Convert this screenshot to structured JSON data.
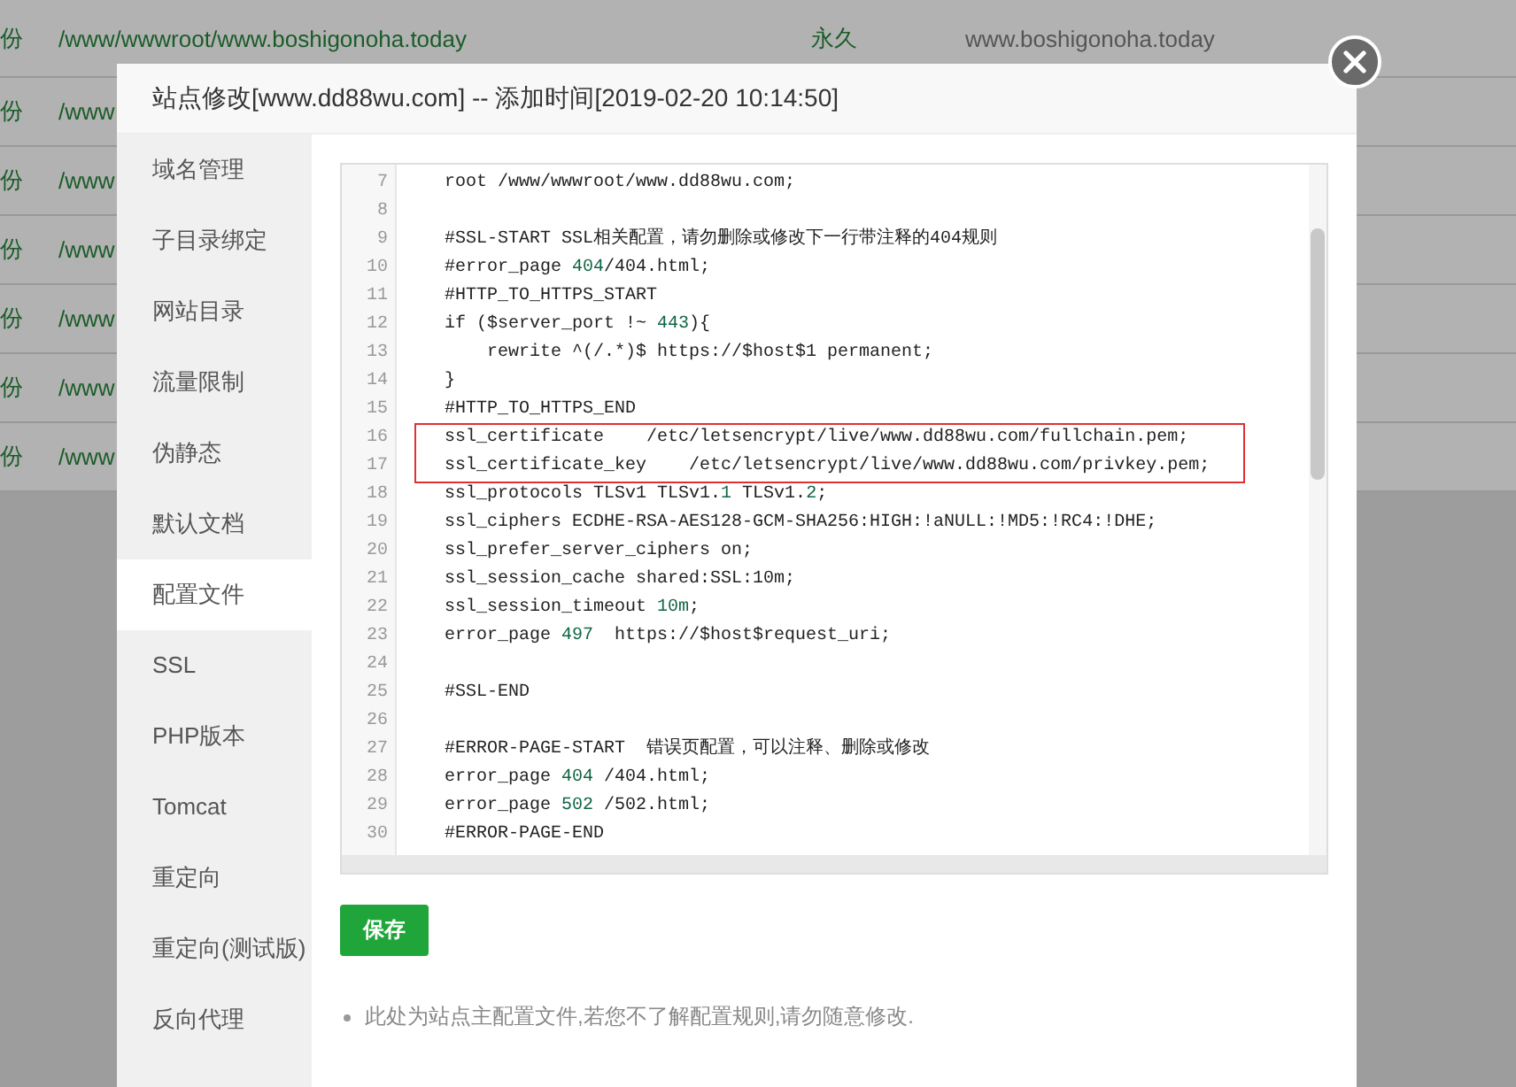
{
  "background_table": {
    "rows": [
      {
        "column_1": "份",
        "path": "/www/wwwroot/www.boshigonoha.today",
        "expiry": "永久",
        "domain": "www.boshigonoha.today"
      },
      {
        "column_1": "份",
        "path": "/www"
      },
      {
        "column_1": "份",
        "path": "/www"
      },
      {
        "column_1": "份",
        "path": "/www"
      },
      {
        "column_1": "份",
        "path": "/www"
      },
      {
        "column_1": "份",
        "path": "/www"
      },
      {
        "column_1": "份",
        "path": "/www"
      }
    ]
  },
  "dialog": {
    "title": "站点修改[www.dd88wu.com] -- 添加时间[2019-02-20 10:14:50]",
    "sidebar": {
      "items": [
        {
          "label": "域名管理",
          "selected": false
        },
        {
          "label": "子目录绑定",
          "selected": false
        },
        {
          "label": "网站目录",
          "selected": false
        },
        {
          "label": "流量限制",
          "selected": false
        },
        {
          "label": "伪静态",
          "selected": false
        },
        {
          "label": "默认文档",
          "selected": false
        },
        {
          "label": "配置文件",
          "selected": true
        },
        {
          "label": "SSL",
          "selected": false
        },
        {
          "label": "PHP版本",
          "selected": false
        },
        {
          "label": "Tomcat",
          "selected": false
        },
        {
          "label": "重定向",
          "selected": false
        },
        {
          "label": "重定向(测试版)",
          "selected": false
        },
        {
          "label": "反向代理",
          "selected": false
        }
      ]
    },
    "code": {
      "lines": [
        {
          "number": "7",
          "highlighted": false,
          "segments": [
            {
              "kind": "plain",
              "text": "    root /www/wwwroot/www.dd88wu.com;"
            }
          ]
        },
        {
          "number": "8",
          "highlighted": false
        },
        {
          "number": "9",
          "highlighted": false,
          "segments": [
            {
              "kind": "plain",
              "text": "    #SSL-START SSL相关配置，请勿删除或修改下一行带注释的404规则"
            }
          ]
        },
        {
          "number": "10",
          "highlighted": false,
          "segments": [
            {
              "kind": "plain",
              "text": "    #error_page "
            },
            {
              "kind": "number",
              "text": "404"
            },
            {
              "kind": "plain",
              "text": "/404.html;"
            }
          ]
        },
        {
          "number": "11",
          "highlighted": false,
          "segments": [
            {
              "kind": "plain",
              "text": "    #HTTP_TO_HTTPS_START"
            }
          ]
        },
        {
          "number": "12",
          "highlighted": false,
          "segments": [
            {
              "kind": "plain",
              "text": "    if ($server_port !~ "
            },
            {
              "kind": "number",
              "text": "443"
            },
            {
              "kind": "plain",
              "text": "){"
            }
          ]
        },
        {
          "number": "13",
          "highlighted": false,
          "segments": [
            {
              "kind": "plain",
              "text": "        rewrite ^(/.*)$ https://$host$1 permanent;"
            }
          ]
        },
        {
          "number": "14",
          "highlighted": false,
          "segments": [
            {
              "kind": "plain",
              "text": "    }"
            }
          ]
        },
        {
          "number": "15",
          "highlighted": false,
          "segments": [
            {
              "kind": "plain",
              "text": "    #HTTP_TO_HTTPS_END"
            }
          ]
        },
        {
          "number": "16",
          "highlighted": true,
          "segments": [
            {
              "kind": "plain",
              "text": "    ssl_certificate    /etc/letsencrypt/live/www.dd88wu.com/fullchain.pem;"
            }
          ]
        },
        {
          "number": "17",
          "highlighted": true,
          "segments": [
            {
              "kind": "plain",
              "text": "    ssl_certificate_key    /etc/letsencrypt/live/www.dd88wu.com/privkey.pem;"
            }
          ]
        },
        {
          "number": "18",
          "highlighted": false,
          "segments": [
            {
              "kind": "plain",
              "text": "    ssl_protocols TLSv1 TLSv1."
            },
            {
              "kind": "number",
              "text": "1"
            },
            {
              "kind": "plain",
              "text": " TLSv1."
            },
            {
              "kind": "number",
              "text": "2"
            },
            {
              "kind": "plain",
              "text": ";"
            }
          ]
        },
        {
          "number": "19",
          "highlighted": false,
          "segments": [
            {
              "kind": "plain",
              "text": "    ssl_ciphers ECDHE-RSA-AES128-GCM-SHA256:HIGH:!aNULL:!MD5:!RC4:!DHE;"
            }
          ]
        },
        {
          "number": "20",
          "highlighted": false,
          "segments": [
            {
              "kind": "plain",
              "text": "    ssl_prefer_server_ciphers on;"
            }
          ]
        },
        {
          "number": "21",
          "highlighted": false,
          "segments": [
            {
              "kind": "plain",
              "text": "    ssl_session_cache shared:SSL:10m;"
            }
          ]
        },
        {
          "number": "22",
          "highlighted": false,
          "segments": [
            {
              "kind": "plain",
              "text": "    ssl_session_timeout "
            },
            {
              "kind": "number",
              "text": "10m"
            },
            {
              "kind": "plain",
              "text": ";"
            }
          ]
        },
        {
          "number": "23",
          "highlighted": false,
          "segments": [
            {
              "kind": "plain",
              "text": "    error_page "
            },
            {
              "kind": "number",
              "text": "497"
            },
            {
              "kind": "plain",
              "text": "  https://$host$request_uri;"
            }
          ]
        },
        {
          "number": "24",
          "highlighted": false
        },
        {
          "number": "25",
          "highlighted": false,
          "segments": [
            {
              "kind": "plain",
              "text": "    #SSL-END"
            }
          ]
        },
        {
          "number": "26",
          "highlighted": false
        },
        {
          "number": "27",
          "highlighted": false,
          "segments": [
            {
              "kind": "plain",
              "text": "    #ERROR-PAGE-START  错误页配置，可以注释、删除或修改"
            }
          ]
        },
        {
          "number": "28",
          "highlighted": false,
          "segments": [
            {
              "kind": "plain",
              "text": "    error_page "
            },
            {
              "kind": "number",
              "text": "404"
            },
            {
              "kind": "plain",
              "text": " /404.html;"
            }
          ]
        },
        {
          "number": "29",
          "highlighted": false,
          "segments": [
            {
              "kind": "plain",
              "text": "    error_page "
            },
            {
              "kind": "number",
              "text": "502"
            },
            {
              "kind": "plain",
              "text": " /502.html;"
            }
          ]
        },
        {
          "number": "30",
          "highlighted": false,
          "segments": [
            {
              "kind": "plain",
              "text": "    #ERROR-PAGE-END"
            }
          ]
        }
      ]
    },
    "save_button": "保存",
    "note": "此处为站点主配置文件,若您不了解配置规则,请勿随意修改."
  }
}
